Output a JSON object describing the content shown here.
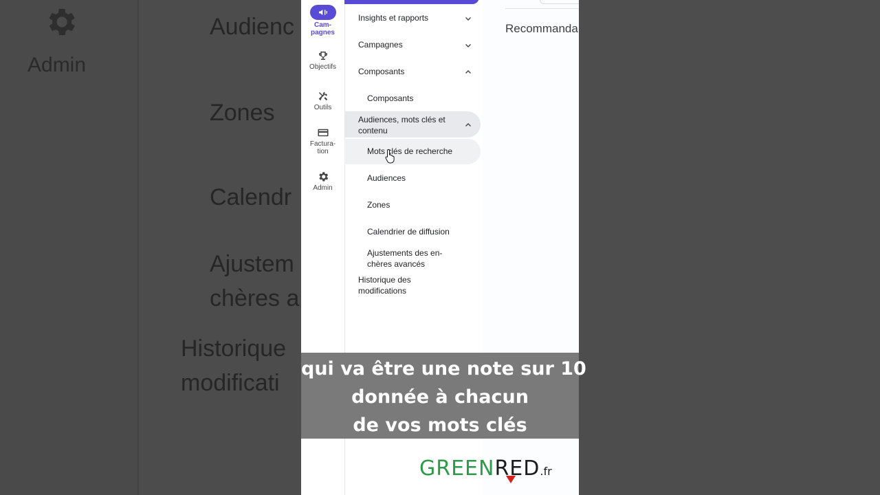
{
  "background": {
    "admin_label": "Admin",
    "blurred_items": [
      "Audienc",
      "Zones",
      "Calendr",
      "Ajustem",
      "chères a",
      "Historique",
      "modificati"
    ]
  },
  "rail": [
    {
      "label": "Cam-\npagnes",
      "label_line1": "Cam-",
      "label_line2": "pagnes",
      "icon": "megaphone-icon",
      "active": true
    },
    {
      "label": "Objectifs",
      "icon": "trophy-icon",
      "active": false
    },
    {
      "label": "Outils",
      "icon": "tools-icon",
      "active": false
    },
    {
      "label_line1": "Factura-",
      "label_line2": "tion",
      "icon": "credit-card-icon",
      "active": false
    },
    {
      "label": "Admin",
      "icon": "gear-icon",
      "active": false
    }
  ],
  "nav": {
    "insights": "Insights et rapports",
    "campagnes": "Campagnes",
    "composants_group": "Composants",
    "composants": "Composants",
    "audiences_group_line1": "Audiences, mots clés et",
    "audiences_group_line2": "contenu",
    "mots_cles": "Mots clés de recherche",
    "audiences": "Audiences",
    "zones": "Zones",
    "calendrier": "Calendrier de diffusion",
    "ajustements_line1": "Ajustements des en-",
    "ajustements_line2": "chères avancés",
    "historique_line1": "Historique des",
    "historique_line2": "modifications"
  },
  "content": {
    "title": "Recommanda"
  },
  "caption": {
    "line1": "qui va être une note sur 10",
    "line2": "donnée à chacun",
    "line3": "de vos mots clés"
  },
  "logo": {
    "part1": "GREEN",
    "part2": "RED",
    "suffix": ".fr"
  },
  "colors": {
    "accent": "#5a4bd6",
    "logo_green": "#2d9a47",
    "logo_red": "#d62020"
  }
}
